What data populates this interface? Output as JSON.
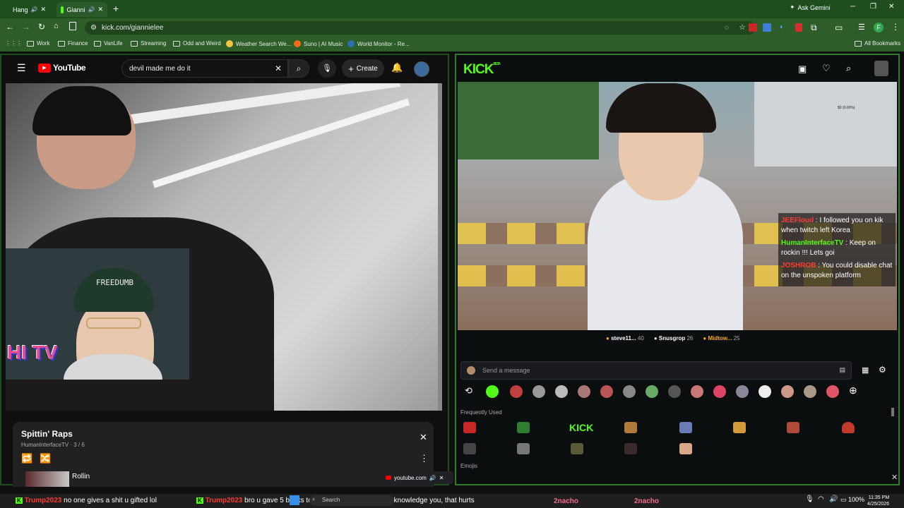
{
  "browser": {
    "tabs": [
      {
        "title": "Hang"
      },
      {
        "title": "Gianni"
      }
    ],
    "new_tab": "+",
    "ask_gemini": "Ask Gemini",
    "url": "kick.com/giannielee",
    "bookmarks": [
      "Work",
      "Finance",
      "VanLife",
      "Streaming",
      "Odd and Weird",
      "Weather Search We...",
      "Suno | AI Music",
      "World Monitor - Re..."
    ],
    "all_bookmarks": "All Bookmarks",
    "profile_initial": "F"
  },
  "youtube": {
    "logo": "YouTube",
    "search_value": "devil made me do it",
    "create_label": "Create",
    "playlist": {
      "title": "Spittin' Raps",
      "meta": "HumanInterfaceTV · 3 / 6",
      "next_item": "Rollin"
    },
    "overlay_logo": "HI TV",
    "cap_text": "FREEDUMB"
  },
  "kick": {
    "logo": "KICK",
    "beta": "BETA",
    "overlay_small": "$0 (0.00%)",
    "chat_overlay": [
      {
        "user": "JEEFloud",
        "text": "I followed you on kik when twitch left Korea",
        "color": "#ff3b30"
      },
      {
        "user": "HumanInterfaceTV",
        "text": "Keep on rockin !!! Lets goi",
        "color": "#53fc18"
      },
      {
        "user": "JOSHROB",
        "text": "You could disable chat on the unspoken platform",
        "color": "#ff3b30"
      }
    ],
    "leaderboard": [
      {
        "name": "steve11...",
        "count": "40",
        "color": "#f5a623"
      },
      {
        "name": "Snusgrop",
        "count": "26",
        "color": "#dddddd"
      },
      {
        "name": "Midtow...",
        "count": "25",
        "color": "#f5a623"
      }
    ],
    "send_placeholder": "Send a message",
    "frequently_used": "Frequently Used",
    "emojis_label": "Emojis",
    "kick_emote": "KICK"
  },
  "mini_player": {
    "label": "youtube.com"
  },
  "taskbar": {
    "ticker1_user": "Trump2023",
    "ticker1_text": "no one gives a shit u gifted lol",
    "ticker2_user": "Trump2023",
    "ticker2_text": "bro u gave 5 bucks to film and he didn't even acknowledge you, that hurts",
    "search": "Search",
    "brand": "2nacho",
    "brand2": "2nacho",
    "battery": "100%",
    "time": "11:35 PM",
    "date": "4/25/2026"
  },
  "colors": {
    "chrome_green": "#2d5e2a",
    "kick_green": "#53fc18",
    "yt_red": "#ff0000"
  }
}
